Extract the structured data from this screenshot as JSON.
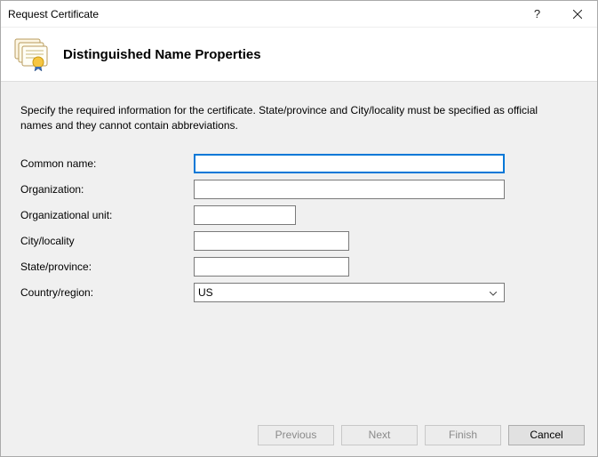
{
  "window": {
    "title": "Request Certificate"
  },
  "header": {
    "icon": "certificate-stack-icon",
    "heading": "Distinguished Name Properties"
  },
  "instructions": "Specify the required information for the certificate. State/province and City/locality must be specified as official names and they cannot contain abbreviations.",
  "form": {
    "common_name": {
      "label": "Common name:",
      "value": ""
    },
    "organization": {
      "label": "Organization:",
      "value": ""
    },
    "organizational_unit": {
      "label": "Organizational unit:",
      "value": ""
    },
    "city_locality": {
      "label": "City/locality",
      "value": ""
    },
    "state_province": {
      "label": "State/province:",
      "value": ""
    },
    "country_region": {
      "label": "Country/region:",
      "value": "US"
    }
  },
  "footer": {
    "previous": "Previous",
    "next": "Next",
    "finish": "Finish",
    "cancel": "Cancel"
  },
  "colors": {
    "panel_bg": "#f0f0f0",
    "focus_border": "#0078d7"
  }
}
